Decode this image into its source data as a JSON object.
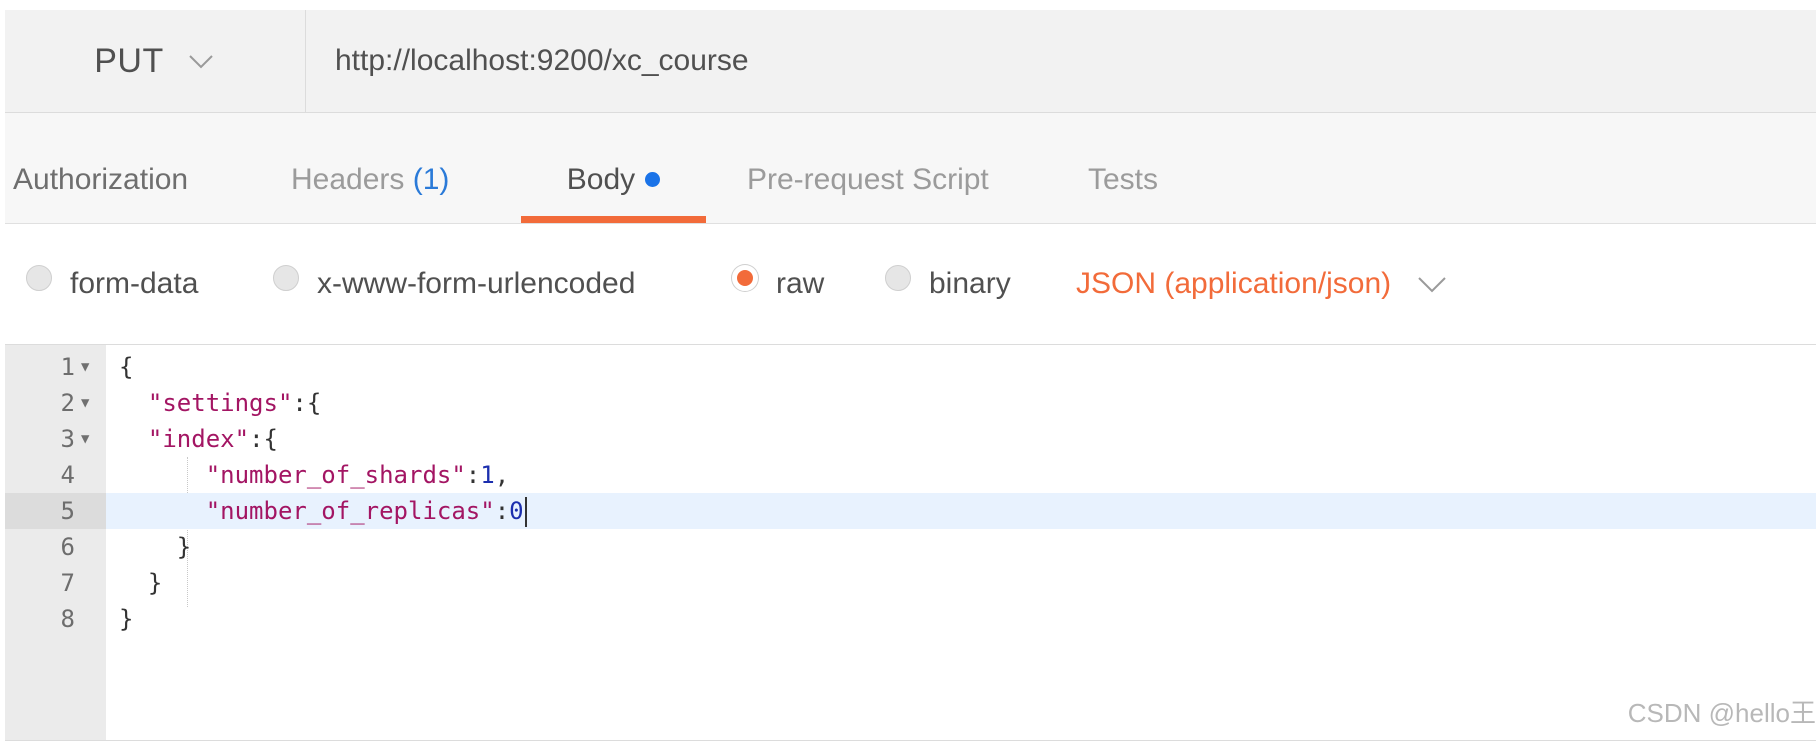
{
  "request": {
    "method": "PUT",
    "url": "http://localhost:9200/xc_course"
  },
  "tabs": {
    "authorization": "Authorization",
    "headers_label": "Headers",
    "headers_count": "(1)",
    "body": "Body",
    "prerequest": "Pre-request Script",
    "tests": "Tests"
  },
  "body_types": {
    "form_data": "form-data",
    "urlencoded": "x-www-form-urlencoded",
    "raw": "raw",
    "binary": "binary",
    "selected": "raw",
    "content_type": "JSON (application/json)"
  },
  "editor": {
    "active_line": 5,
    "lines": [
      {
        "num": "1",
        "code": "{"
      },
      {
        "num": "2",
        "code": "  \"settings\":{"
      },
      {
        "num": "3",
        "code": "  \"index\":{"
      },
      {
        "num": "4",
        "code": "      \"number_of_shards\":1,"
      },
      {
        "num": "5",
        "code": "      \"number_of_replicas\":0"
      },
      {
        "num": "6",
        "code": "    }"
      },
      {
        "num": "7",
        "code": "  }"
      },
      {
        "num": "8",
        "code": "}"
      }
    ]
  },
  "watermark": "CSDN @hello王",
  "colors": {
    "accent": "#f26b3a",
    "link_blue": "#2a7ad8",
    "string": "#a31563",
    "number": "#1c2fae"
  },
  "icons": {
    "method_dropdown": "chevron-down-icon",
    "content_type_dropdown": "chevron-down-icon",
    "fold": "fold-arrow-icon"
  }
}
